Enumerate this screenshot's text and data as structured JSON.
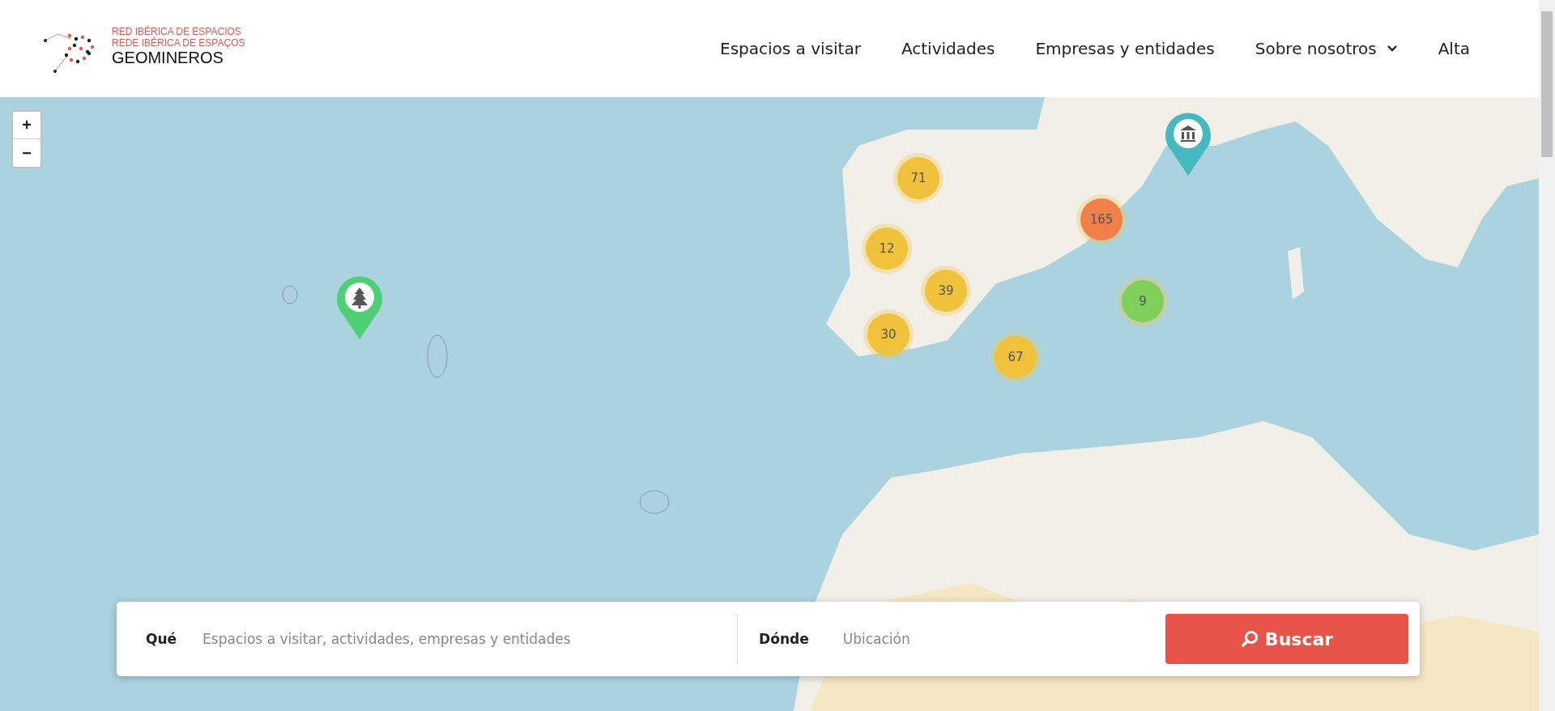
{
  "logo": {
    "line_1": "RED IBÉRICA DE ESPACIOS",
    "line_2": "REDE IBÉRICA DE ESPAÇOS",
    "name": "GEOMINEROS"
  },
  "nav": [
    {
      "label": "Espacios a visitar",
      "kind": "link"
    },
    {
      "label": "Actividades",
      "kind": "link"
    },
    {
      "label": "Empresas y entidades",
      "kind": "link"
    },
    {
      "label": "Sobre nosotros",
      "kind": "dropdown"
    },
    {
      "label": "Alta",
      "kind": "link"
    }
  ],
  "map": {
    "zoom_in": "+",
    "zoom_out": "−",
    "clusters": [
      {
        "count": "71",
        "color": "#f0c23b"
      },
      {
        "count": "165",
        "color": "#f07f4a"
      },
      {
        "count": "12",
        "color": "#f0c23b"
      },
      {
        "count": "39",
        "color": "#f0c23b"
      },
      {
        "count": "9",
        "color": "#7fcf5a"
      },
      {
        "count": "30",
        "color": "#f0c23b"
      },
      {
        "count": "67",
        "color": "#f0c23b"
      }
    ],
    "pins": [
      {
        "kind": "museum",
        "color": "#45b9c0"
      },
      {
        "kind": "tree",
        "color": "#4fcf73"
      }
    ]
  },
  "search": {
    "what_label": "Qué",
    "what_placeholder": "Espacios a visitar, actividades, empresas y entidades",
    "where_label": "Dónde",
    "where_placeholder": "Ubicación",
    "button": "Buscar"
  }
}
